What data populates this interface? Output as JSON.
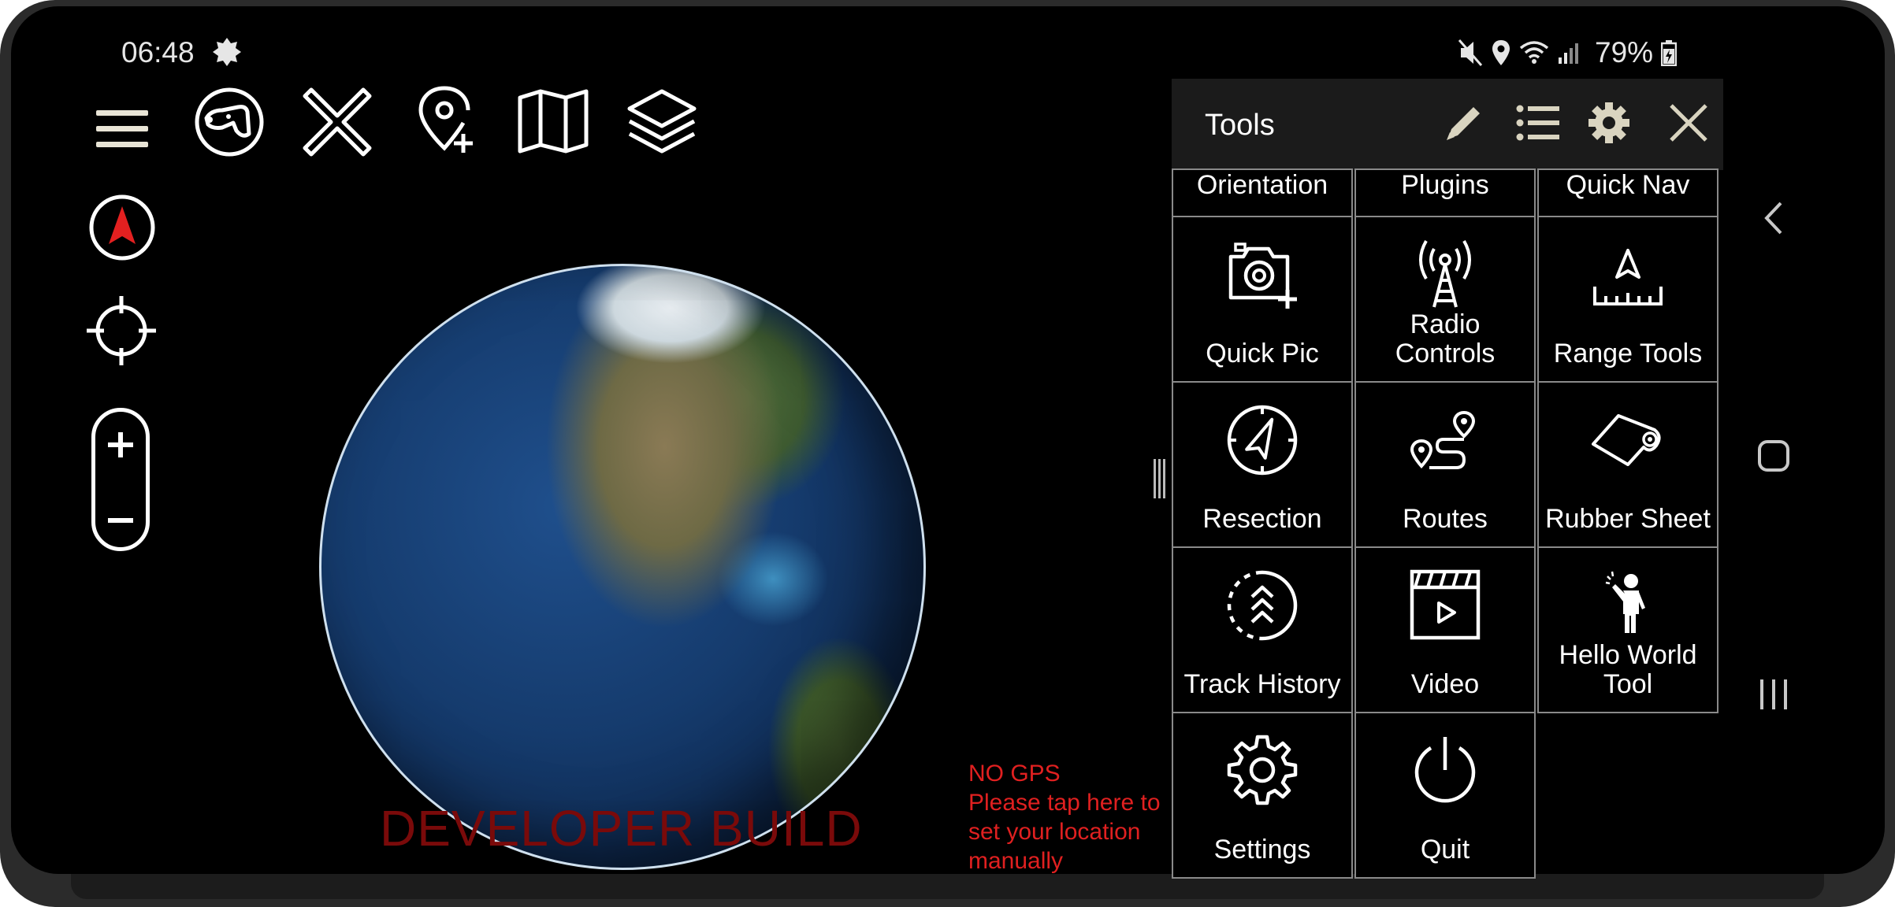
{
  "status_bar": {
    "time": "06:48",
    "battery_percent": "79%",
    "icons": [
      "notification-gear-icon",
      "mute-icon",
      "location-icon",
      "wifi-icon",
      "signal-icon",
      "battery-icon"
    ]
  },
  "toolbar": {
    "icons": [
      "menu-icon",
      "dog-icon",
      "close-x-icon",
      "add-location-pin-icon",
      "map-icon",
      "layers-icon"
    ]
  },
  "map_overlay": {
    "developer_build": "DEVELOPER BUILD",
    "no_gps": "NO GPS\nPlease tap here to\nset your location\nmanually"
  },
  "tools_panel": {
    "title": "Tools",
    "header_icons": [
      "pencil-icon",
      "list-icon",
      "gear-icon",
      "close-icon"
    ],
    "top_row": [
      "Orientation",
      "Plugins",
      "Quick Nav"
    ],
    "items": [
      {
        "label": "Quick Pic",
        "icon": "camera-plus-icon"
      },
      {
        "label": "Radio Controls",
        "icon": "radio-tower-icon"
      },
      {
        "label": "Range Tools",
        "icon": "range-ruler-icon"
      },
      {
        "label": "Resection",
        "icon": "compass-icon"
      },
      {
        "label": "Routes",
        "icon": "route-icon"
      },
      {
        "label": "Rubber Sheet",
        "icon": "rubber-sheet-icon"
      },
      {
        "label": "Track History",
        "icon": "track-history-icon"
      },
      {
        "label": "Video",
        "icon": "video-icon"
      },
      {
        "label": "Hello World Tool",
        "icon": "hello-person-icon"
      },
      {
        "label": "Settings",
        "icon": "settings-gear-icon"
      },
      {
        "label": "Quit",
        "icon": "power-icon"
      }
    ]
  },
  "nav_bar": {
    "icons": [
      "back-icon",
      "home-icon",
      "recents-icon"
    ]
  }
}
